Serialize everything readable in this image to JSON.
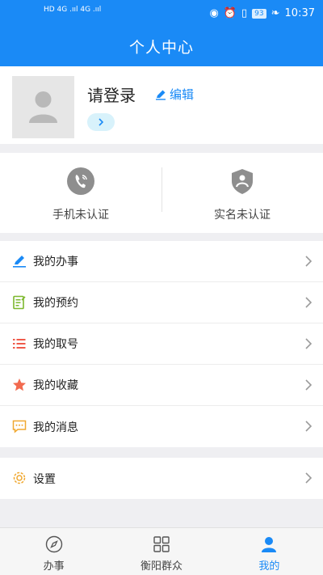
{
  "status_bar": {
    "network_left": "HD 4G .ııl 4G .ııl",
    "battery": "93",
    "time": "10:37"
  },
  "header": {
    "title": "个人中心"
  },
  "profile": {
    "name": "请登录",
    "edit_label": "编辑"
  },
  "verification": [
    {
      "label": "手机未认证",
      "icon": "phone-icon"
    },
    {
      "label": "实名未认证",
      "icon": "shield-icon"
    }
  ],
  "menu": [
    {
      "label": "我的办事",
      "icon": "pencil-icon",
      "color": "#1a8af6"
    },
    {
      "label": "我的预约",
      "icon": "note-icon",
      "color": "#7db82e"
    },
    {
      "label": "我的取号",
      "icon": "list-icon",
      "color": "#ef5a4a"
    },
    {
      "label": "我的收藏",
      "icon": "star-icon",
      "color": "#f26a4f"
    },
    {
      "label": "我的消息",
      "icon": "message-icon",
      "color": "#f0a830"
    }
  ],
  "settings": {
    "label": "设置",
    "icon": "gear-icon",
    "color": "#f0a830"
  },
  "tabs": [
    {
      "label": "办事",
      "icon": "compass-icon",
      "active": false
    },
    {
      "label": "衡阳群众",
      "icon": "grid-icon",
      "active": false
    },
    {
      "label": "我的",
      "icon": "person-icon",
      "active": true
    }
  ],
  "colors": {
    "primary": "#1a8af6",
    "background": "#efeff2"
  }
}
